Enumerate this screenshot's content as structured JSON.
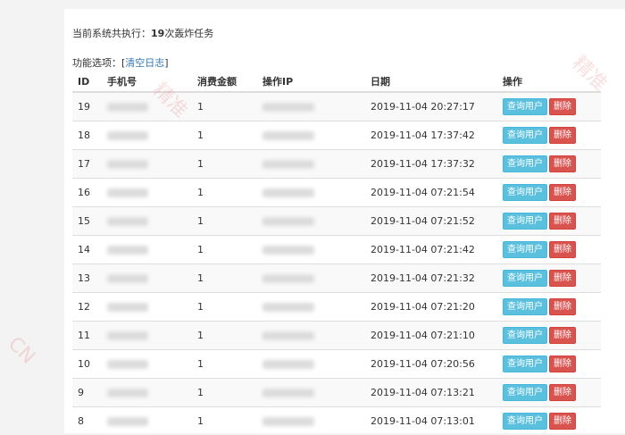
{
  "summary": {
    "prefix": "当前系统共执行：",
    "count": "19",
    "suffix": "次轰炸任务"
  },
  "options": {
    "label": "功能选项：",
    "open_bracket": "[",
    "clear_log": "清空日志",
    "close_bracket": "]"
  },
  "table": {
    "headers": [
      "ID",
      "手机号",
      "消费金额",
      "操作IP",
      "日期",
      "操作"
    ],
    "rows": [
      {
        "id": "19",
        "amount": "1",
        "date": "2019-11-04 20:27:17"
      },
      {
        "id": "18",
        "amount": "1",
        "date": "2019-11-04 17:37:42"
      },
      {
        "id": "17",
        "amount": "1",
        "date": "2019-11-04 17:37:32"
      },
      {
        "id": "16",
        "amount": "1",
        "date": "2019-11-04 07:21:54"
      },
      {
        "id": "15",
        "amount": "1",
        "date": "2019-11-04 07:21:52"
      },
      {
        "id": "14",
        "amount": "1",
        "date": "2019-11-04 07:21:42"
      },
      {
        "id": "13",
        "amount": "1",
        "date": "2019-11-04 07:21:32"
      },
      {
        "id": "12",
        "amount": "1",
        "date": "2019-11-04 07:21:20"
      },
      {
        "id": "11",
        "amount": "1",
        "date": "2019-11-04 07:21:10"
      },
      {
        "id": "10",
        "amount": "1",
        "date": "2019-11-04 07:20:56"
      },
      {
        "id": "9",
        "amount": "1",
        "date": "2019-11-04 07:13:21"
      },
      {
        "id": "8",
        "amount": "1",
        "date": "2019-11-04 07:13:01"
      }
    ],
    "query_label": "查询用户",
    "delete_label": "删除"
  },
  "watermark": [
    "精准",
    "精准",
    "CN"
  ],
  "colors": {
    "link": "#337ab7",
    "info": "#5bc0de",
    "danger": "#d9534f"
  }
}
